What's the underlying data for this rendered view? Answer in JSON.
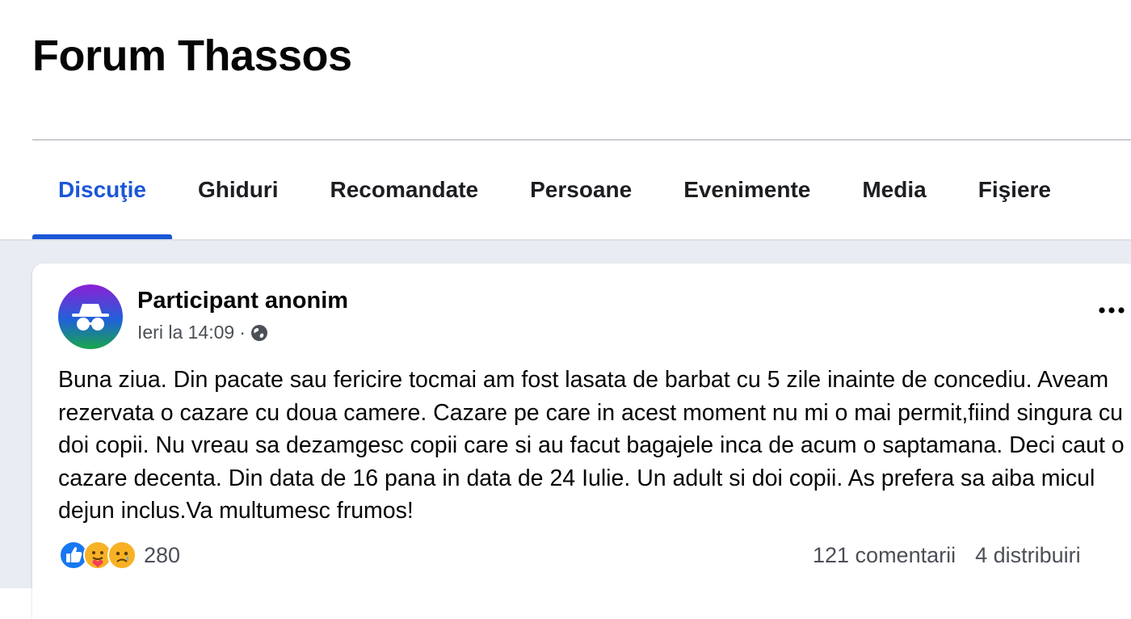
{
  "group": {
    "title": "Forum Thassos"
  },
  "tabs": [
    {
      "label": "Discuţie"
    },
    {
      "label": "Ghiduri"
    },
    {
      "label": "Recomandate"
    },
    {
      "label": "Persoane"
    },
    {
      "label": "Evenimente"
    },
    {
      "label": "Media"
    },
    {
      "label": "Fişiere"
    }
  ],
  "active_tab": "Discuţie",
  "post": {
    "author": "Participant anonim",
    "time": "Ieri la 14:09",
    "separator": "·",
    "privacy_icon": "globe-icon",
    "text": "Buna ziua. Din pacate sau fericire tocmai am fost lasata de barbat cu 5 zile inainte de concediu. Aveam rezervata o cazare cu doua camere. Cazare pe care in acest moment nu mi o mai permit,fiind singura cu doi copii. Nu vreau sa dezamgesc copii care si au facut bagajele inca de acum o saptamana. Deci caut o cazare decenta. Din data de 16 pana in data de 24 Iulie. Un adult si doi copii. As prefera sa aiba micul dejun inclus.Va multumesc frumos!",
    "reaction_icons": [
      "like-icon",
      "care-icon",
      "sad-icon"
    ],
    "reactions_count": "280",
    "comments": "121 comentarii",
    "shares": "4 distribuiri"
  },
  "colors": {
    "accent": "#1b57d6",
    "feed_background": "#e9ecf2",
    "secondary_text": "#4b4f56",
    "divider": "#c9ccd1"
  }
}
